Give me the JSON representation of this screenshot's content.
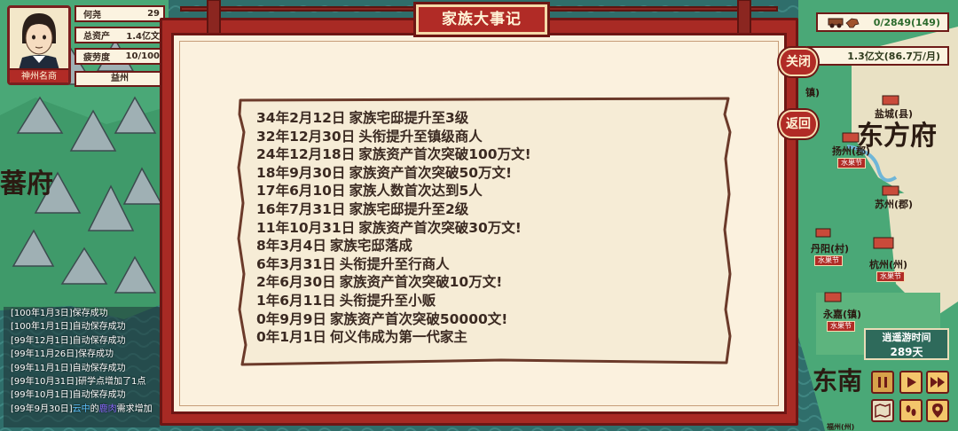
{
  "player": {
    "name": "何尧",
    "name_value": "29",
    "assets_label": "总资产",
    "assets_value": "1.4亿文",
    "fatigue_label": "疲劳度",
    "fatigue_value": "10/100",
    "region": "益州",
    "title_badge": "神州名商"
  },
  "resources": {
    "cart_value": "0/2849(149)",
    "money_value": "1.3亿文(86.7万/月)"
  },
  "buttons": {
    "close": "关闭",
    "back": "返回"
  },
  "modal": {
    "title": "家族大事记",
    "events": [
      {
        "date": "34年2月12日",
        "text": "家族宅邸提升至3级"
      },
      {
        "date": "32年12月30日",
        "text": "头衔提升至镇级商人"
      },
      {
        "date": "24年12月18日",
        "text": "家族资产首次突破100万文!"
      },
      {
        "date": "18年9月30日",
        "text": "家族资产首次突破50万文!"
      },
      {
        "date": "17年6月10日",
        "text": "家族人数首次达到5人"
      },
      {
        "date": "16年7月31日",
        "text": "家族宅邸提升至2级"
      },
      {
        "date": "11年10月31日",
        "text": "家族资产首次突破30万文!"
      },
      {
        "date": "8年3月4日",
        "text": "家族宅邸落成"
      },
      {
        "date": "6年3月31日",
        "text": "头衔提升至行商人"
      },
      {
        "date": "2年6月30日",
        "text": "家族资产首次突破10万文!"
      },
      {
        "date": "1年6月11日",
        "text": "头衔提升至小贩"
      },
      {
        "date": "0年9月9日",
        "text": "家族资产首次突破50000文!"
      },
      {
        "date": "0年1月1日",
        "text": "何义伟成为第一代家主"
      }
    ]
  },
  "log": [
    "[100年1月3日]保存成功",
    "[100年1月1日]自动保存成功",
    "[99年12月1日]自动保存成功",
    "[99年11月26日]保存成功",
    "[99年11月1日]自动保存成功",
    "[99年10月31日]研学点增加了1点",
    "[99年10月1日]自动保存成功"
  ],
  "log_last": {
    "prefix": "[99年9月30日]",
    "hl1": "云中",
    "mid": "的",
    "hl2": "鹿肉",
    "suffix": "需求增加"
  },
  "map": {
    "region_left": "蕃府",
    "region_right": "东方府",
    "region_bottom": "东南",
    "cities": {
      "yancheng": "盐城(县)",
      "yangzhou": "扬州(郡)",
      "suzhou": "苏州(郡)",
      "danyang": "丹阳(村)",
      "hangzhou": "杭州(州)",
      "yongjia": "永嘉(镇)",
      "zhen": "镇)",
      "fuzhou_partial": "福州(州)"
    },
    "tag_text": "水果节"
  },
  "time": {
    "label": "逍遥游时间",
    "value": "289天"
  },
  "colors": {
    "frame_red": "#a82a24",
    "parchment": "#fbf1de",
    "dark_red": "#6d1614"
  }
}
